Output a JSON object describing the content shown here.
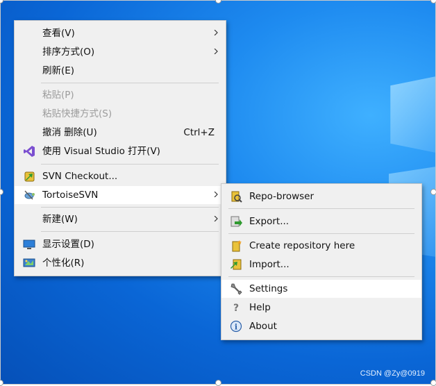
{
  "desktop_menu": {
    "items": [
      {
        "label": "查看(V)",
        "has_submenu": true
      },
      {
        "label": "排序方式(O)",
        "has_submenu": true
      },
      {
        "label": "刷新(E)"
      },
      {
        "label": "粘贴(P)",
        "disabled": true
      },
      {
        "label": "粘贴快捷方式(S)",
        "disabled": true
      },
      {
        "label": "撤消 删除(U)",
        "shortcut": "Ctrl+Z"
      },
      {
        "label": "使用 Visual Studio 打开(V)",
        "icon": "visual-studio-icon"
      },
      {
        "label": "SVN Checkout...",
        "icon": "svn-checkout-icon"
      },
      {
        "label": "TortoiseSVN",
        "icon": "tortoisesvn-icon",
        "has_submenu": true,
        "highlighted": true
      },
      {
        "label": "新建(W)",
        "has_submenu": true
      },
      {
        "label": "显示设置(D)",
        "icon": "display-settings-icon"
      },
      {
        "label": "个性化(R)",
        "icon": "personalize-icon"
      }
    ]
  },
  "tortoise_submenu": {
    "items": [
      {
        "label": "Repo-browser",
        "icon": "repo-browser-icon"
      },
      {
        "label": "Export...",
        "icon": "export-icon"
      },
      {
        "label": "Create repository here",
        "icon": "create-repository-icon"
      },
      {
        "label": "Import...",
        "icon": "import-icon"
      },
      {
        "label": "Settings",
        "icon": "settings-icon",
        "highlighted": true
      },
      {
        "label": "Help",
        "icon": "help-icon"
      },
      {
        "label": "About",
        "icon": "about-icon"
      }
    ]
  },
  "watermark": "CSDN @Zy@0919",
  "colors": {
    "desktop": "#0a66d6",
    "menu_bg": "#f0f0f0",
    "highlight": "#ffffff",
    "disabled": "#9c9c9c"
  }
}
